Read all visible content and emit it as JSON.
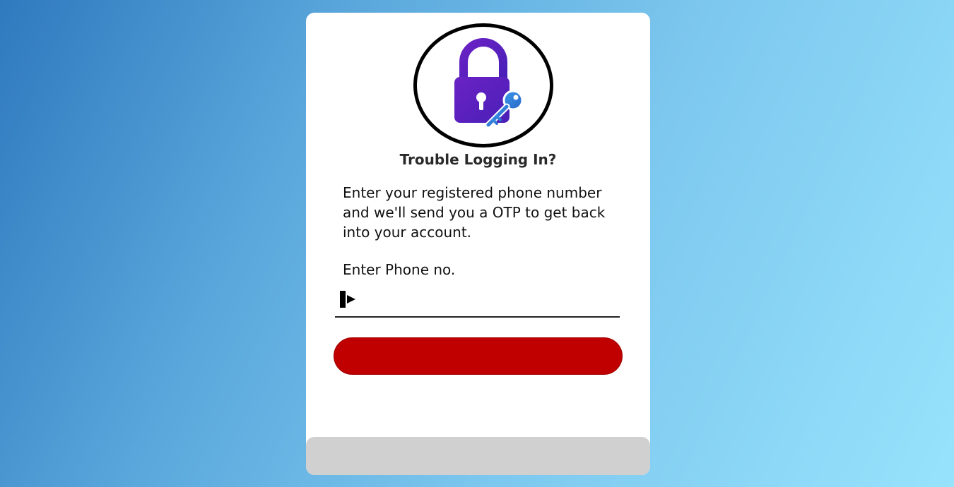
{
  "recovery": {
    "title": "Trouble Logging In?",
    "description": "Enter your registered phone number and we'll send you a OTP to get back into your account.",
    "phone_label": "Enter Phone no.",
    "phone_value": "",
    "submit_label": ""
  },
  "icons": {
    "logo": "lock-with-key-icon",
    "phone_prefix": "cursor-play-icon"
  },
  "colors": {
    "lock": "#5a1fc0",
    "key": "#2f86e0",
    "button": "#c00000",
    "footer": "#d1d0d1"
  }
}
